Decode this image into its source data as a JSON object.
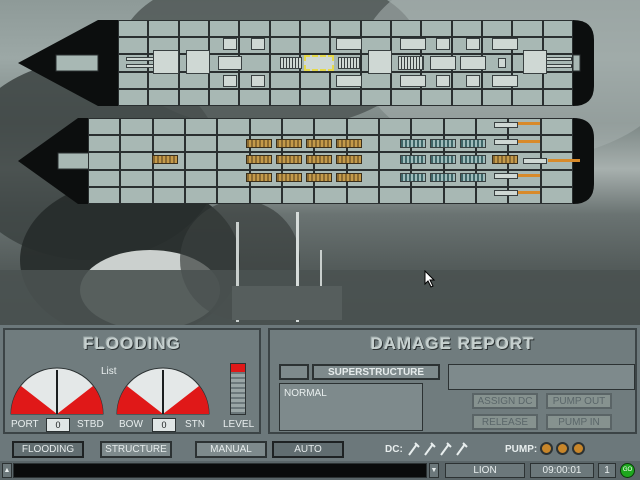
{
  "flooding_panel": {
    "title": "FLOODING",
    "list_label": "List",
    "port_label": "PORT",
    "port_value": "0",
    "stbd_label": "STBD",
    "bow_label": "BOW",
    "bow_value": "0",
    "stn_label": "STN",
    "level_label": "LEVEL"
  },
  "damage_panel": {
    "title": "DAMAGE REPORT",
    "section_label": "SUPERSTRUCTURE",
    "status_text": "NORMAL",
    "assign_dc_label": "ASSIGN DC",
    "pump_out_label": "PUMP OUT",
    "release_label": "RELEASE",
    "pump_in_label": "PUMP IN"
  },
  "toolbar": {
    "flooding_label": "FLOODING",
    "structure_label": "STRUCTURE",
    "manual_label": "MANUAL",
    "auto_label": "AUTO",
    "dc_label": "DC:",
    "pump_label": "PUMP:"
  },
  "statusbar": {
    "ship_name": "LION",
    "clock": "09:00:01",
    "speed_setting": "1",
    "go_label": "GO"
  },
  "icons": {
    "dc_teams": [
      "wrench-icon",
      "wrench-icon",
      "wrench-icon",
      "wrench-icon"
    ],
    "pumps": [
      "pump-icon",
      "pump-icon",
      "pump-icon"
    ]
  },
  "colors": {
    "flood_red": "#e01818",
    "hull_cell": "#a8b8b4",
    "pump_orange": "#d88a2a",
    "go_green": "#1ea81e"
  }
}
